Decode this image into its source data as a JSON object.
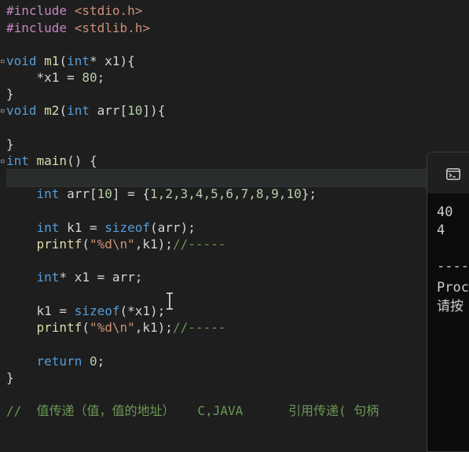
{
  "editor": {
    "lines": [
      {
        "parts": [
          {
            "c": "pp",
            "t": "#include "
          },
          {
            "c": "str",
            "t": "<stdio.h>"
          }
        ]
      },
      {
        "parts": [
          {
            "c": "pp",
            "t": "#include "
          },
          {
            "c": "str",
            "t": "<stdlib.h>"
          }
        ]
      },
      {
        "parts": [
          {
            "c": "kw",
            "t": "void "
          },
          {
            "c": "fn",
            "t": "m1"
          },
          {
            "c": "txt",
            "t": "("
          },
          {
            "c": "kw",
            "t": "int"
          },
          {
            "c": "txt",
            "t": "* x1){"
          }
        ]
      },
      {
        "parts": [
          {
            "c": "txt",
            "t": "    *x1 = "
          },
          {
            "c": "num",
            "t": "80"
          },
          {
            "c": "txt",
            "t": ";"
          }
        ]
      },
      {
        "parts": [
          {
            "c": "txt",
            "t": "}"
          }
        ]
      },
      {
        "parts": [
          {
            "c": "kw",
            "t": "void "
          },
          {
            "c": "fn",
            "t": "m2"
          },
          {
            "c": "txt",
            "t": "("
          },
          {
            "c": "kw",
            "t": "int"
          },
          {
            "c": "txt",
            "t": " arr["
          },
          {
            "c": "num",
            "t": "10"
          },
          {
            "c": "txt",
            "t": "]){"
          }
        ]
      },
      {
        "parts": [
          {
            "c": "txt",
            "t": "}"
          }
        ]
      },
      {
        "parts": [
          {
            "c": "kw",
            "t": "int "
          },
          {
            "c": "fn",
            "t": "main"
          },
          {
            "c": "txt",
            "t": "() {"
          }
        ]
      },
      {
        "parts": [
          {
            "c": "txt",
            "t": "    "
          },
          {
            "c": "kw",
            "t": "int"
          },
          {
            "c": "txt",
            "t": " arr["
          },
          {
            "c": "num",
            "t": "10"
          },
          {
            "c": "txt",
            "t": "] = {"
          },
          {
            "c": "num",
            "t": "1,2,3,4,5,6,7,8,9,10"
          },
          {
            "c": "txt",
            "t": "};"
          }
        ]
      },
      {
        "parts": [
          {
            "c": "txt",
            "t": "    "
          },
          {
            "c": "kw",
            "t": "int"
          },
          {
            "c": "txt",
            "t": " k1 = "
          },
          {
            "c": "kw",
            "t": "sizeof"
          },
          {
            "c": "txt",
            "t": "(arr);"
          }
        ]
      },
      {
        "parts": [
          {
            "c": "txt",
            "t": "    "
          },
          {
            "c": "fn",
            "t": "printf"
          },
          {
            "c": "txt",
            "t": "("
          },
          {
            "c": "str",
            "t": "\"%d\\n\""
          },
          {
            "c": "txt",
            "t": ",k1);"
          },
          {
            "c": "cm",
            "t": "//-----"
          }
        ]
      },
      {
        "parts": [
          {
            "c": "txt",
            "t": "    "
          },
          {
            "c": "kw",
            "t": "int"
          },
          {
            "c": "txt",
            "t": "* x1 = arr;"
          }
        ]
      },
      {
        "parts": [
          {
            "c": "txt",
            "t": "    k1 = "
          },
          {
            "c": "kw",
            "t": "sizeof"
          },
          {
            "c": "txt",
            "t": "(*x1);"
          }
        ]
      },
      {
        "parts": [
          {
            "c": "txt",
            "t": "    "
          },
          {
            "c": "fn",
            "t": "printf"
          },
          {
            "c": "txt",
            "t": "("
          },
          {
            "c": "str",
            "t": "\"%d\\n\""
          },
          {
            "c": "txt",
            "t": ",k1);"
          },
          {
            "c": "cm",
            "t": "//-----"
          }
        ]
      },
      {
        "parts": [
          {
            "c": "txt",
            "t": "    "
          },
          {
            "c": "kw",
            "t": "return "
          },
          {
            "c": "num",
            "t": "0"
          },
          {
            "c": "txt",
            "t": ";"
          }
        ]
      },
      {
        "parts": [
          {
            "c": "txt",
            "t": "}"
          }
        ]
      },
      {
        "parts": [
          {
            "c": "cm",
            "t": "//  值传递（值，值的地址）   C,JAVA      引用传递( 句柄"
          }
        ]
      }
    ]
  },
  "terminal": {
    "icon": "terminal-icon",
    "lines": [
      "40",
      "4",
      "",
      "----",
      "Proc",
      "请按"
    ]
  }
}
